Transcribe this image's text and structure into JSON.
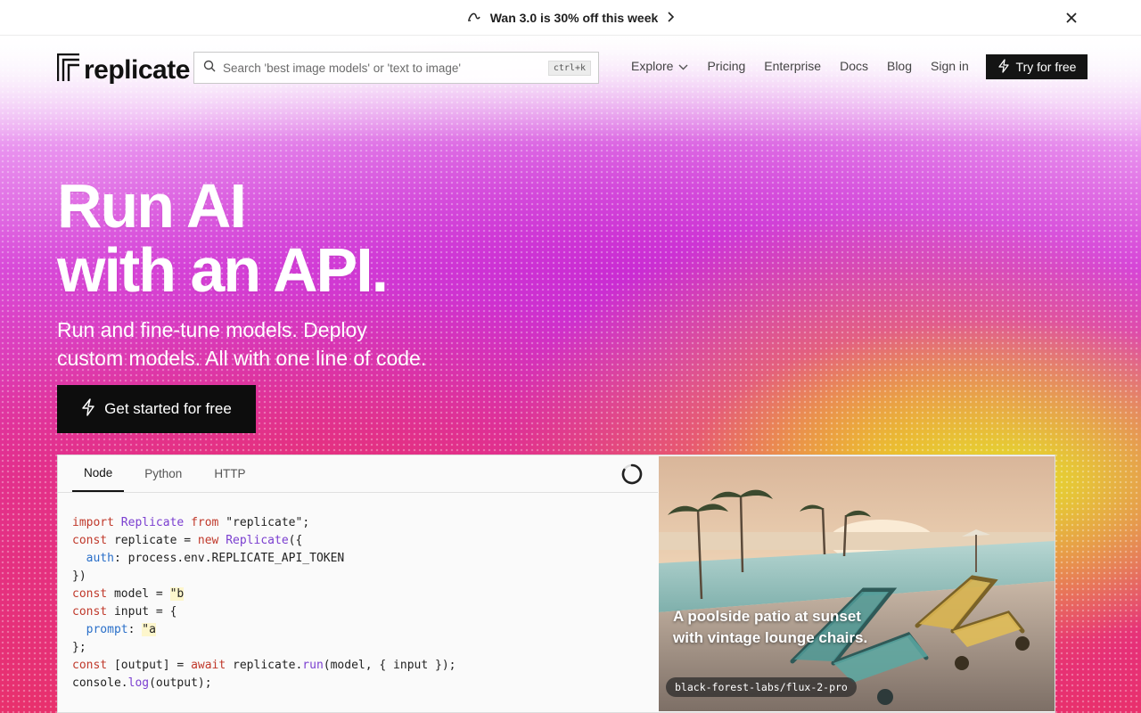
{
  "announcement": {
    "text": "Wan 3.0 is 30% off this week"
  },
  "brand": {
    "name": "replicate"
  },
  "search": {
    "placeholder": "Search 'best image models' or 'text to image'",
    "shortcut": "ctrl+k"
  },
  "nav": {
    "explore": "Explore",
    "pricing": "Pricing",
    "enterprise": "Enterprise",
    "docs": "Docs",
    "blog": "Blog",
    "sign_in": "Sign in",
    "try_free": "Try for free"
  },
  "hero": {
    "line1": "Run AI",
    "line2": "with an API.",
    "sub_line1": "Run and fine-tune models. Deploy",
    "sub_line2": "custom models. All with one line of code.",
    "cta": "Get started for free"
  },
  "demo": {
    "tabs": [
      "Node",
      "Python",
      "HTTP"
    ],
    "active_tab": "Node",
    "code": {
      "l1_import": "import",
      "l1_cls": "Replicate",
      "l1_from": "from",
      "l1_str": "\"replicate\"",
      "l1_end": ";",
      "l2_const": "const",
      "l2_mid": " replicate = ",
      "l2_new": "new",
      "l2_cls": "Replicate",
      "l2_end": "({",
      "l3_prop": "auth",
      "l3_rest": ": process.env.REPLICATE_API_TOKEN",
      "l4": "})",
      "l5_const": "const",
      "l5_mid": " model = ",
      "l5_str": "\"b",
      "l6_const": "const",
      "l6_mid": " input = {",
      "l7_prop": "prompt",
      "l7_colon": ": ",
      "l7_str": "\"a",
      "l8": "};",
      "l9_const": "const",
      "l9_mid": " [output] = ",
      "l9_await": "await",
      "l9_obj": " replicate.",
      "l9_fn": "run",
      "l9_end": "(model, { input });",
      "l10_obj": "console.",
      "l10_fn": "log",
      "l10_end": "(output);"
    },
    "image": {
      "caption": "A poolside patio at sunset with vintage lounge chairs.",
      "model": "black-forest-labs/flux-2-pro"
    }
  },
  "colors": {
    "cta_bg": "#0d0d0d",
    "accent_pink": "#d84ad8",
    "accent_yellow": "#e4e828"
  }
}
